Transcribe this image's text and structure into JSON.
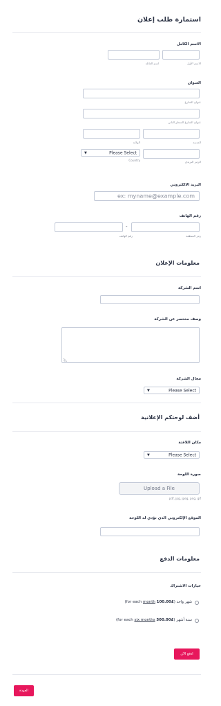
{
  "form_title": "استمارة طلب إعلان",
  "full_name": {
    "label": "الاسم الكامل",
    "first_sub": "الاسم الأول",
    "last_sub": "اسم العائلة"
  },
  "address": {
    "label": "العنوان",
    "street_sub": "عنوان الشارع",
    "street2_sub": "عنوان الشارع السطر الثاني",
    "city_sub": "المدينة",
    "state_sub": "الولاية",
    "zip_sub": "الرمز البريدي",
    "country_value": "Please Select",
    "country_sub": "Country"
  },
  "email": {
    "label": "البريد الالكتروني",
    "placeholder": "ex: myname@example.com"
  },
  "phone": {
    "label": "رقم الهاتف",
    "area_sub": "رمز المنطقة",
    "number_sub": "رقم الهاتف",
    "dash": "-"
  },
  "section_ad": {
    "title": "معلومات الإعلان"
  },
  "company": {
    "name_label": "اسم الشركة",
    "desc_label": "وصف مختصر عن الشركة",
    "field_label": "مجال الشركة",
    "field_value": "Please Select"
  },
  "section_board": {
    "title": "أضف لوحتكم الإعلانية"
  },
  "board": {
    "location_label": "مكان اللافتة",
    "location_value": "Please Select",
    "image_label": "صورة اللوحة",
    "upload_label": "Upload a File",
    "upload_types": "pdf, jpg, jpeg, png, gif",
    "website_label": "الموقع الإلكتروني الذي تؤدي له اللوحة"
  },
  "section_payment": {
    "title": "معلومات الدفع"
  },
  "payment": {
    "options_label": "خيارات الاشتراك",
    "opt1_name": "شهر واحد",
    "opt1_amount": "100.00£",
    "opt1_for": "(for each",
    "opt1_period": "month",
    "opt1_close": ")",
    "opt2_name": "سنة أشهر",
    "opt2_amount": "500.00£",
    "opt2_for": "(for each",
    "opt2_period": "six months",
    "opt2_close": ")"
  },
  "buttons": {
    "pay": "ادفع الآن",
    "back": "العودة"
  },
  "colors": {
    "accent": "#e7175c",
    "border": "#c3cad8",
    "text": "#2c3345"
  }
}
